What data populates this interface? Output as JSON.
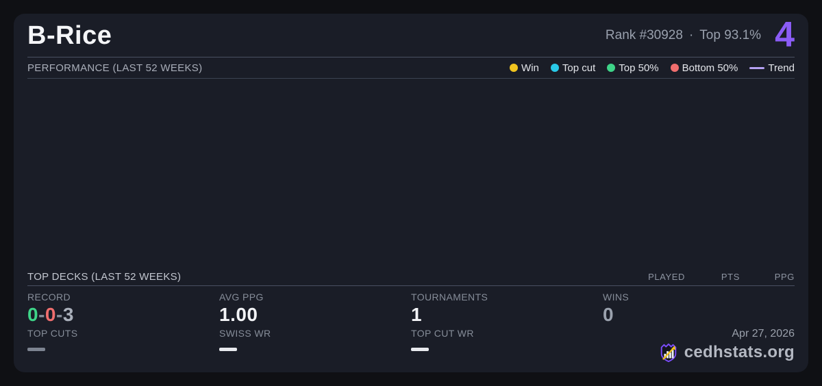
{
  "page": {
    "background_color": "#0f1014",
    "card_color": "#1a1d27"
  },
  "header": {
    "title": "B-Rice",
    "rank": "Rank #30928",
    "dot": "·",
    "top_percent": "Top 93.1%",
    "points": "4",
    "points_color": "#8b5cf6"
  },
  "performance": {
    "heading": "PERFORMANCE (LAST 52 WEEKS)",
    "legend": [
      {
        "label": "Win",
        "color": "#f0c41f",
        "swatch": "dot"
      },
      {
        "label": "Top cut",
        "color": "#29c9e8",
        "swatch": "dot"
      },
      {
        "label": "Top 50%",
        "color": "#3ed488",
        "swatch": "dot"
      },
      {
        "label": "Bottom 50%",
        "color": "#f06e6e",
        "swatch": "dot"
      },
      {
        "label": "Trend",
        "color": "#b5a1f2",
        "swatch": "line"
      }
    ],
    "chart_data": {
      "type": "scatter",
      "points": [],
      "title": "PERFORMANCE (LAST 52 WEEKS)"
    }
  },
  "top_decks": {
    "heading": "TOP DECKS (LAST 52 WEEKS)",
    "columns": [
      "PLAYED",
      "PTS",
      "PPG"
    ],
    "rows": []
  },
  "stats": {
    "record": {
      "label": "RECORD",
      "parts": [
        {
          "text": "0",
          "color": "#3ed488"
        },
        {
          "text": "-",
          "color": "#8a919d"
        },
        {
          "text": "0",
          "color": "#f06e6e"
        },
        {
          "text": "-",
          "color": "#8a919d"
        },
        {
          "text": "3",
          "color": "#aab0bb"
        }
      ]
    },
    "avg_ppg": {
      "label": "AVG PPG",
      "value": "1.00"
    },
    "tournaments": {
      "label": "TOURNAMENTS",
      "value": "1"
    },
    "wins": {
      "label": "WINS",
      "value": "0"
    },
    "top_cuts": {
      "label": "TOP CUTS",
      "dash_color": "#7d8491"
    },
    "swiss_wr": {
      "label": "SWISS WR",
      "dash_color": "#e8eaee"
    },
    "top_cut_wr": {
      "label": "TOP CUT WR",
      "dash_color": "#e8eaee"
    }
  },
  "branding": {
    "date": "Apr 27, 2026",
    "site": "cedhstats.org",
    "logo_icon": "shield-chart-arrow-icon"
  }
}
